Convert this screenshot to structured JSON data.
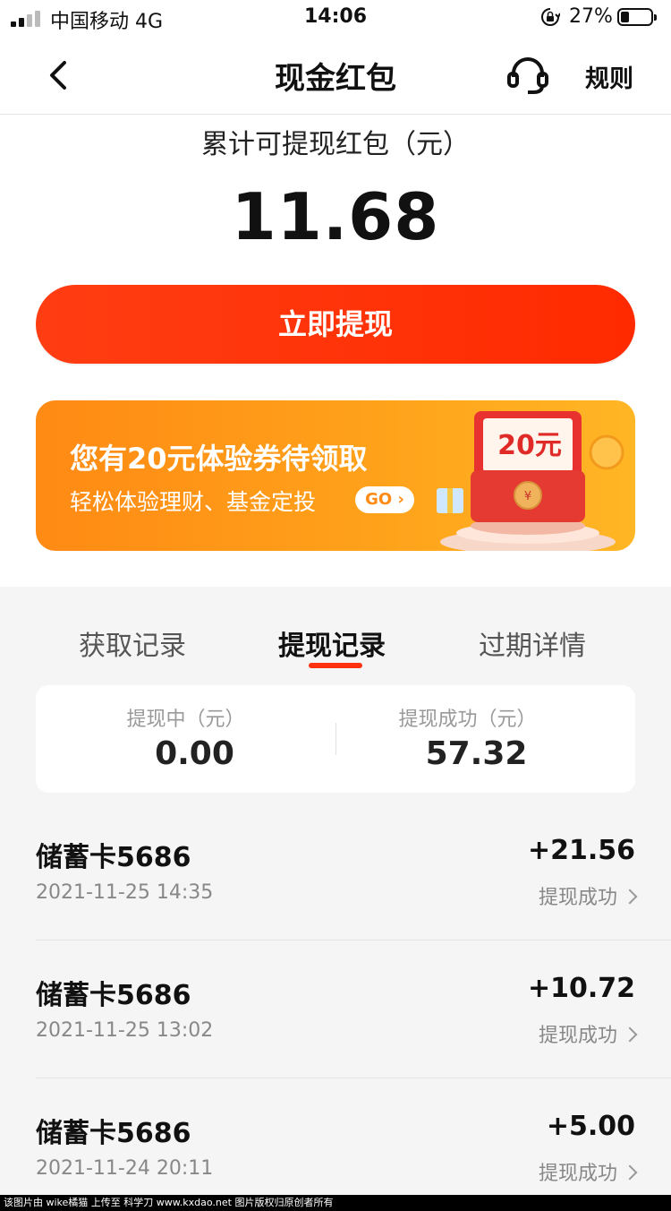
{
  "status_bar": {
    "carrier": "中国移动  4G",
    "time": "14:06",
    "battery_percent": "27%"
  },
  "nav": {
    "title": "现金红包",
    "rules_label": "规则",
    "icons": {
      "back": "chevron-left-icon",
      "service": "headset-icon"
    }
  },
  "summary": {
    "label": "累计可提现红包（元）",
    "amount": "11.68",
    "withdraw_button": "立即提现"
  },
  "banner": {
    "title": "您有20元体验券待领取",
    "subtitle": "轻松体验理财、基金定投",
    "go_label": "GO",
    "voucher_text": "20元"
  },
  "tabs": [
    {
      "label": "获取记录",
      "active": false
    },
    {
      "label": "提现记录",
      "active": true
    },
    {
      "label": "过期详情",
      "active": false
    }
  ],
  "stats": {
    "pending_label": "提现中（元）",
    "pending_value": "0.00",
    "success_label": "提现成功（元）",
    "success_value": "57.32"
  },
  "records": [
    {
      "name": "储蓄卡5686",
      "time": "2021-11-25 14:35",
      "amount": "+21.56",
      "status": "提现成功"
    },
    {
      "name": "储蓄卡5686",
      "time": "2021-11-25 13:02",
      "amount": "+10.72",
      "status": "提现成功"
    },
    {
      "name": "储蓄卡5686",
      "time": "2021-11-24 20:11",
      "amount": "+5.00",
      "status": "提现成功"
    }
  ],
  "watermark": "该图片由 wike橘猫 上传至 科学刀 www.kxdao.net 图片版权归原创者所有",
  "colors": {
    "accent": "#ff2a00",
    "banner": "#ff9a18",
    "background_gray": "#f5f5f5"
  }
}
